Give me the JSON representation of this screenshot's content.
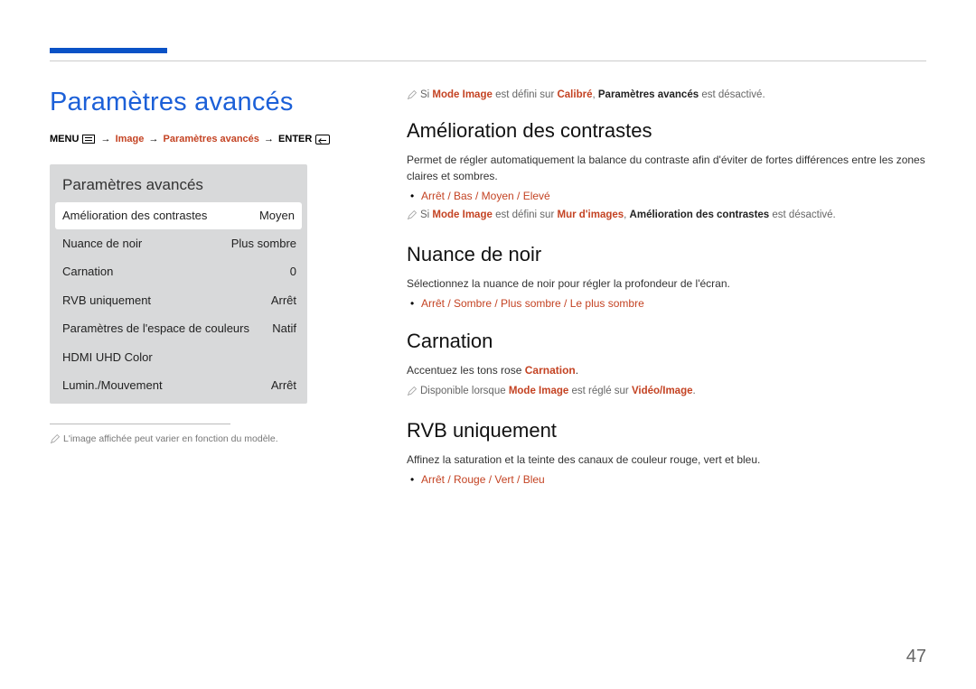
{
  "page_number": "47",
  "left": {
    "title": "Paramètres avancés",
    "breadcrumb": {
      "pre": "MENU",
      "arrow": "→",
      "image": "Image",
      "settings": "Paramètres avancés",
      "enter": "ENTER"
    },
    "panel": {
      "title": "Paramètres avancés",
      "rows": [
        {
          "label": "Amélioration des contrastes",
          "value": "Moyen",
          "active": true
        },
        {
          "label": "Nuance de noir",
          "value": "Plus sombre"
        },
        {
          "label": "Carnation",
          "value": "0"
        },
        {
          "label": "RVB uniquement",
          "value": "Arrêt"
        },
        {
          "label": "Paramètres de l'espace de couleurs",
          "value": "Natif"
        },
        {
          "label": "HDMI UHD Color",
          "value": ""
        },
        {
          "label": "Lumin./Mouvement",
          "value": "Arrêt"
        }
      ]
    },
    "footnote": "L'image affichée peut varier en fonction du modèle."
  },
  "right": {
    "topnote": {
      "pre": "Si ",
      "mode": "Mode Image",
      "mid": " est défini sur ",
      "cal": "Calibré",
      "mid2": ", ",
      "pa": "Paramètres avancés",
      "end": " est désactivé."
    },
    "sections": {
      "contrast": {
        "title": "Amélioration des contrastes",
        "desc": "Permet de régler automatiquement la balance du contraste afin d'éviter de fortes différences entre les zones claires et sombres.",
        "opts": "Arrêt / Bas / Moyen / Elevé",
        "note": {
          "pre": "Si ",
          "mode": "Mode Image",
          "mid": " est défini sur ",
          "mur": "Mur d'images",
          "mid2": ", ",
          "ac": "Amélioration des contrastes",
          "end": " est désactivé."
        }
      },
      "noir": {
        "title": "Nuance de noir",
        "desc": "Sélectionnez la nuance de noir pour régler la profondeur de l'écran.",
        "opts": "Arrêt / Sombre / Plus sombre / Le plus sombre"
      },
      "carnation": {
        "title": "Carnation",
        "desc_pre": "Accentuez les tons rose ",
        "desc_hl": "Carnation",
        "desc_end": ".",
        "note": {
          "pre": "Disponible lorsque ",
          "mode": "Mode Image",
          "mid": " est réglé sur ",
          "vi": "Vidéo/Image",
          "end": "."
        }
      },
      "rvb": {
        "title": "RVB uniquement",
        "desc": "Affinez la saturation et la teinte des canaux de couleur rouge, vert et bleu.",
        "opts": "Arrêt / Rouge / Vert / Bleu"
      }
    }
  }
}
